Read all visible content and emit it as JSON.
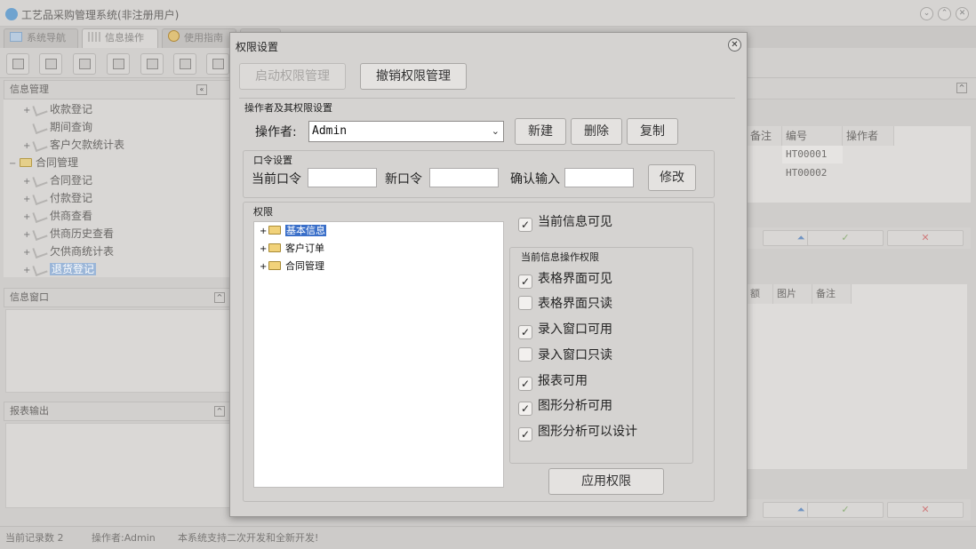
{
  "app": {
    "title": "工艺品采购管理系统(非注册用户)",
    "window_controls": [
      "⌄",
      "⌃",
      "✕"
    ]
  },
  "tabs": [
    {
      "label": "系统导航"
    },
    {
      "label": "信息操作"
    },
    {
      "label": "使用指南"
    }
  ],
  "left_panel": {
    "info_mgmt_title": "信息管理",
    "collapse_glyph": "«",
    "tree": [
      {
        "label": "收款登记",
        "expander": "+"
      },
      {
        "label": "期间查询",
        "expander": ""
      },
      {
        "label": "客户欠款统计表",
        "expander": "+"
      },
      {
        "label": "合同管理",
        "expander": "−"
      },
      {
        "label": "合同登记",
        "expander": "+"
      },
      {
        "label": "付款登记",
        "expander": "+"
      },
      {
        "label": "供商查看",
        "expander": "+"
      },
      {
        "label": "供商历史查看",
        "expander": "+"
      },
      {
        "label": "欠供商统计表",
        "expander": "+"
      },
      {
        "label": "退货登记",
        "expander": "+"
      }
    ],
    "info_window_title": "信息窗口",
    "report_output_title": "报表输出"
  },
  "right_panel": {
    "grid1": {
      "headers": [
        "备注",
        "编号",
        "操作者"
      ],
      "rows": [
        [
          "",
          "HT00001",
          ""
        ],
        [
          "",
          "HT00002",
          ""
        ]
      ]
    },
    "nav_glyphs": [
      "⏶",
      "✓",
      "✕"
    ],
    "grid2": {
      "headers": [
        "额",
        "图片",
        "备注"
      ]
    }
  },
  "status": {
    "record_count": "当前记录数 2",
    "operator": "操作者:Admin",
    "message": "本系统支持二次开发和全新开发!"
  },
  "dialog": {
    "title": "权限设置",
    "close_glyph": "✕",
    "enable_btn": "启动权限管理",
    "revoke_btn": "撤销权限管理",
    "operator_group_label": "操作者及其权限设置",
    "operator_label": "操作者:",
    "operator_value": "Admin",
    "new_btn": "新建",
    "delete_btn": "删除",
    "copy_btn": "复制",
    "password_group_label": "口令设置",
    "current_pwd_label": "当前口令",
    "new_pwd_label": "新口令",
    "confirm_label": "确认输入",
    "modify_btn": "修改",
    "permissions_label": "权限",
    "perm_tree": [
      {
        "label": "基本信息",
        "selected": true
      },
      {
        "label": "客户订单",
        "selected": false
      },
      {
        "label": "合同管理",
        "selected": false
      }
    ],
    "current_visible": {
      "label": "当前信息可见",
      "checked": true
    },
    "ops_group_label": "当前信息操作权限",
    "ops": [
      {
        "label": "表格界面可见",
        "checked": true
      },
      {
        "label": "表格界面只读",
        "checked": false
      },
      {
        "label": "录入窗口可用",
        "checked": true
      },
      {
        "label": "录入窗口只读",
        "checked": false
      },
      {
        "label": "报表可用",
        "checked": true
      },
      {
        "label": "图形分析可用",
        "checked": true
      },
      {
        "label": "图形分析可以设计",
        "checked": true
      }
    ],
    "apply_btn": "应用权限"
  }
}
